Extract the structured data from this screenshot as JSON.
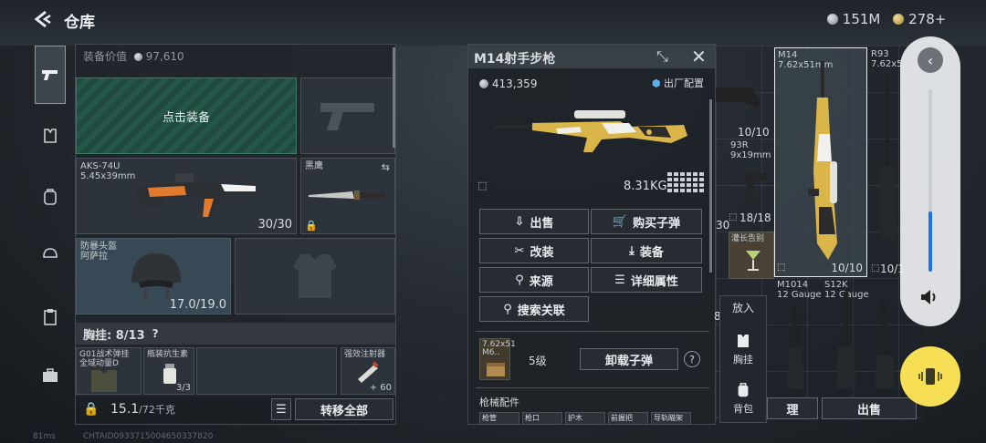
{
  "header": {
    "title": "仓库"
  },
  "currency": {
    "silver": "151M",
    "gold": "278+"
  },
  "sidebar": {
    "icons": [
      "pistol-icon",
      "vest-icon",
      "backpack-icon",
      "helmet-icon",
      "clipboard-icon",
      "briefcase-icon"
    ]
  },
  "equipment": {
    "value_label": "装备价值",
    "value": "97,610",
    "slots": {
      "empty_primary": "点击装备",
      "primary": {
        "name": "AKS-74U",
        "caliber": "5.45x39mm",
        "ammo": "30/30"
      },
      "melee": {
        "name": "黑鹰"
      },
      "helmet": {
        "name": "防暴头盔",
        "sub": "阿萨拉",
        "durability": "17.0/19.0"
      }
    },
    "chest": {
      "label": "胸挂: 8/13",
      "help": "?"
    },
    "chest_items": [
      {
        "name": "G01战术弹挂",
        "sub": "全域动量D"
      },
      {
        "name": "瓶装抗生素",
        "count": "3/3"
      },
      {
        "name": "强效注射器",
        "count": "60"
      }
    ],
    "weight": {
      "current": "15.1",
      "max": "/72千克"
    },
    "transfer_all": "转移全部"
  },
  "detail": {
    "title": "M14射手步枪",
    "price": "413,359",
    "factory": "出厂配置",
    "weight": "8.31KG",
    "actions": [
      {
        "label": "出售",
        "icon": "sell-icon"
      },
      {
        "label": "购买子弹",
        "icon": "cart-icon"
      },
      {
        "label": "改装",
        "icon": "modify-icon"
      },
      {
        "label": "装备",
        "icon": "equip-icon"
      },
      {
        "label": "来源",
        "icon": "search-icon"
      },
      {
        "label": "详细属性",
        "icon": "list-icon"
      },
      {
        "label": "搜索关联",
        "icon": "search-icon"
      }
    ],
    "ammo": {
      "caliber": "7.62x51",
      "sub": "M6..",
      "level": "5级",
      "unload": "卸载子弹",
      "help": "?"
    },
    "attachments_label": "枪械配件",
    "attachment_tabs": [
      "枪管",
      "枪口",
      "护木",
      "前握把",
      "导轨瞄架"
    ]
  },
  "grid": {
    "m14": {
      "name": "M14",
      "caliber": "7.62x51mm",
      "count": "10/10"
    },
    "r93": {
      "name": "R93",
      "caliber": "7.62x5"
    },
    "left_count": "10/10",
    "left_count2": "18/18",
    "left_count3": "30",
    "r93_count": "10/1",
    "m93r": {
      "name": "93R",
      "caliber": "9x19mm"
    },
    "drink": {
      "name": "灌长告别"
    },
    "m1014": {
      "name": "M1014",
      "caliber": "12 Gauge"
    },
    "s12k": {
      "name": "S12K",
      "caliber": "12 Gauge"
    },
    "put_in": "放入",
    "chest_btn": "胸挂",
    "backpack_btn": "背包",
    "organize": "理",
    "sell": "出售",
    "side_number": "8"
  },
  "footer": {
    "fps": "81ms",
    "uid": "CHTAID0933715004650337820"
  }
}
